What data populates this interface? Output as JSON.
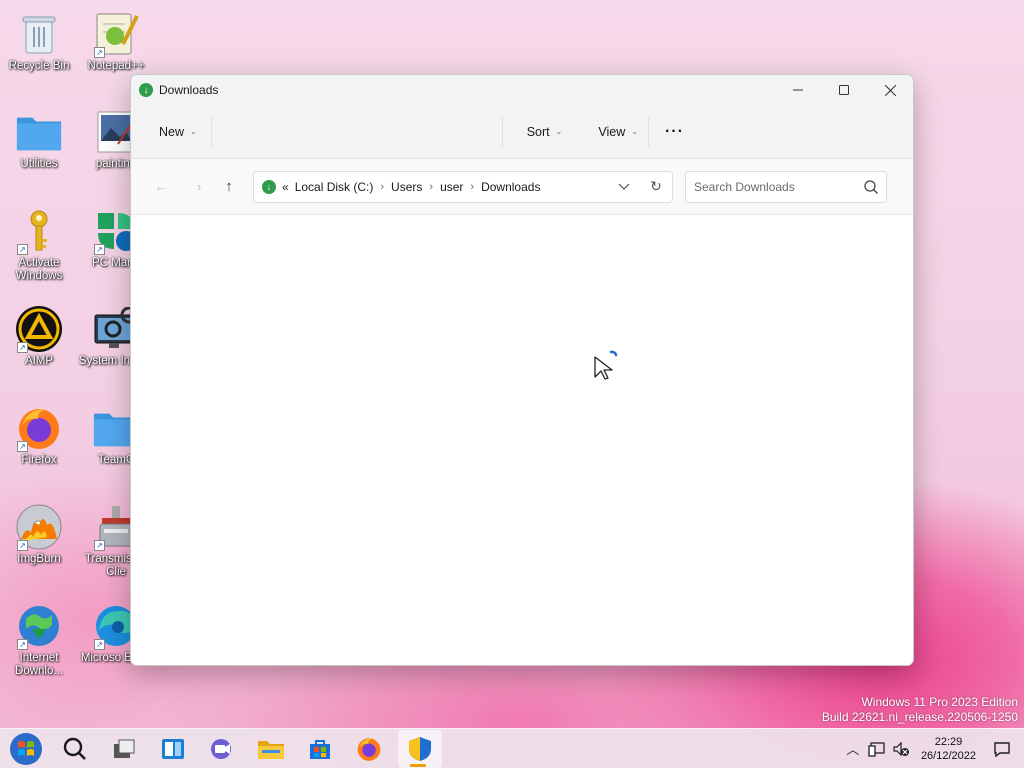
{
  "desktop": {
    "icons": [
      {
        "label": "Recycle Bin"
      },
      {
        "label": "Notepad++"
      },
      {
        "label": "Utilities"
      },
      {
        "label": "painting"
      },
      {
        "label": "Activate Windows"
      },
      {
        "label": "PC Mana"
      },
      {
        "label": "AIMP"
      },
      {
        "label": "System Inform"
      },
      {
        "label": "Firefox"
      },
      {
        "label": "TeamC"
      },
      {
        "label": "ImgBurn"
      },
      {
        "label": "Transmis Qt Clie"
      },
      {
        "label": "Internet Downlo..."
      },
      {
        "label": "Microso Edge"
      }
    ]
  },
  "window": {
    "title": "Downloads",
    "toolbar": {
      "new_label": "New",
      "sort_label": "Sort",
      "view_label": "View",
      "more_label": "···"
    },
    "address": {
      "overflow": "«",
      "crumbs": [
        "Local Disk (C:)",
        "Users",
        "user",
        "Downloads"
      ]
    },
    "search": {
      "placeholder": "Search Downloads"
    }
  },
  "watermark": {
    "line1": "Windows 11 Pro 2023 Edition",
    "line2": "Build 22621.ni_release.220506-1250"
  },
  "taskbar": {
    "time": "22:29",
    "date": "26/12/2022"
  },
  "colors": {
    "accent": "#0067c0",
    "folder": "#f5c33b",
    "download_green": "#2e9d4a"
  }
}
